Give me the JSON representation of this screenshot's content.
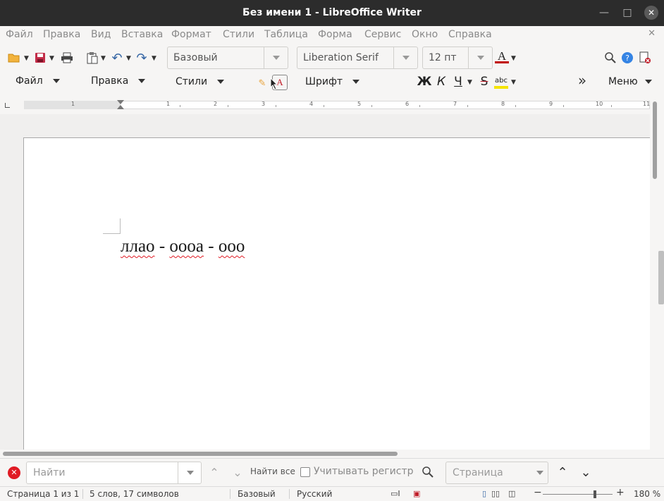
{
  "window": {
    "title": "Без имени 1 - LibreOffice Writer"
  },
  "menu": [
    "Файл",
    "Правка",
    "Вид",
    "Вставка",
    "Формат",
    "Стили",
    "Таблица",
    "Форма",
    "Сервис",
    "Окно",
    "Справка"
  ],
  "toolbar": {
    "paragraph_style": "Базовый",
    "font_name": "Liberation Serif",
    "font_size": "12 пт",
    "groups": {
      "file": "Файл",
      "edit": "Правка",
      "styles": "Стили",
      "font": "Шрифт",
      "menu": "Меню"
    },
    "bold_glyph": "Ж",
    "italic_glyph": "К",
    "underline_glyph": "Ч",
    "strike_glyph": "S",
    "font_color_glyph": "A",
    "highlight_glyph": "abc",
    "overflow_glyph": "»"
  },
  "ruler": {
    "labels": [
      "1",
      "1",
      "2",
      "3",
      "4",
      "5",
      "6",
      "7",
      "8",
      "9",
      "10",
      "11"
    ]
  },
  "document": {
    "words": [
      "ллао",
      " - ",
      "оооа",
      " - ",
      "ооо"
    ]
  },
  "find": {
    "placeholder": "Найти",
    "find_all": "Найти все",
    "match_case": "Учитывать регистр",
    "page_placeholder": "Страница"
  },
  "status": {
    "page": "Страница 1 из 1",
    "counts": "5 слов, 17 символов",
    "page_style": "Базовый",
    "language": "Русский",
    "zoom": "180 %",
    "zoom_level": 0.75
  },
  "colors": {
    "titlebar": "#2c2c2c",
    "font_color": "#c00000",
    "highlight": "#ffff00",
    "spellcheck": "#e01b24"
  }
}
